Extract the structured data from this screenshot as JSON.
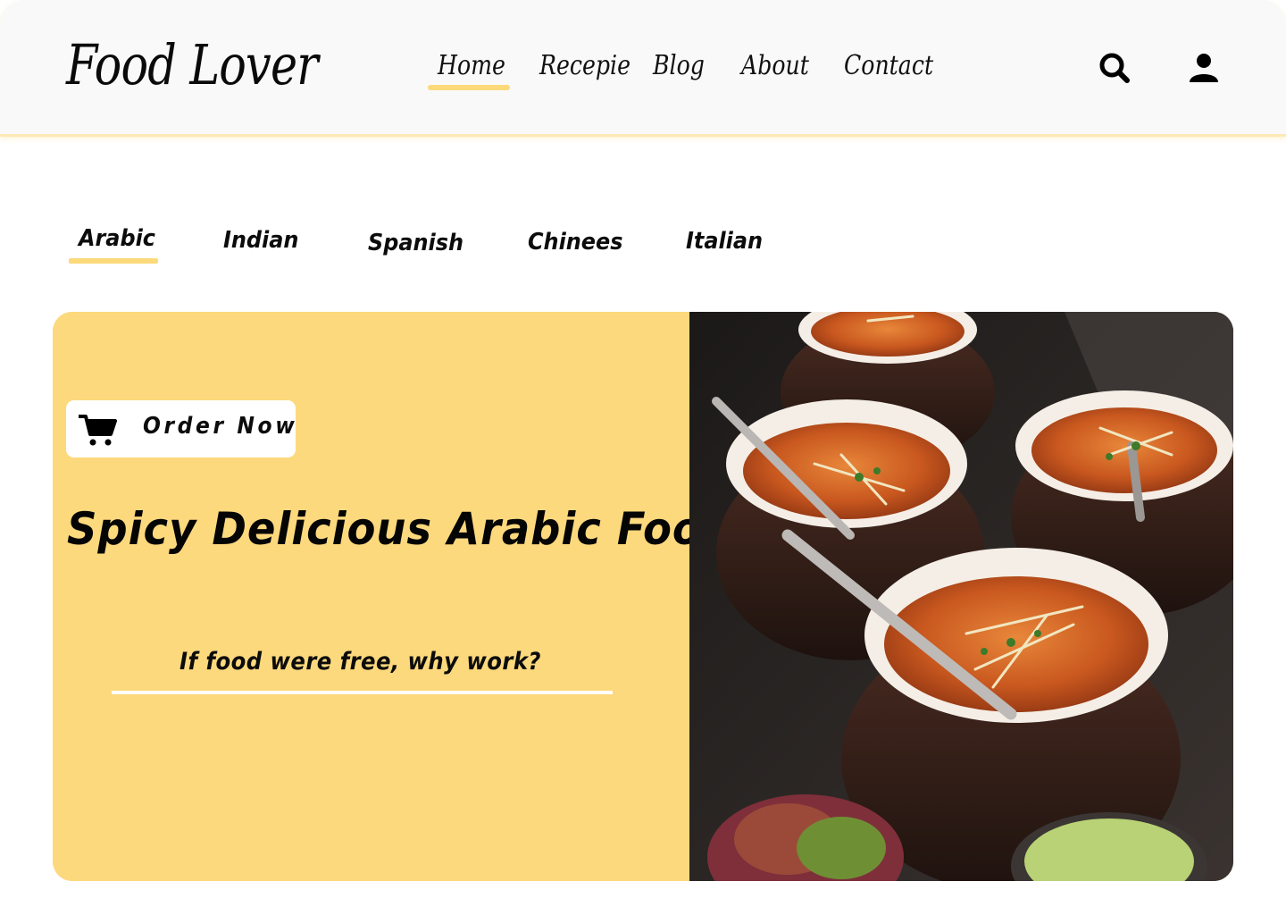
{
  "header": {
    "logo": "Food Lover",
    "nav": [
      {
        "label": "Home",
        "active": true
      },
      {
        "label": "Recepie",
        "active": false
      },
      {
        "label": "Blog",
        "active": false
      },
      {
        "label": "About",
        "active": false
      },
      {
        "label": "Contact",
        "active": false
      }
    ],
    "icons": [
      "search-icon",
      "user-icon"
    ]
  },
  "categories": {
    "tabs": [
      {
        "label": "Arabic",
        "active": true
      },
      {
        "label": "Indian",
        "active": false
      },
      {
        "label": "Spanish",
        "active": false
      },
      {
        "label": "Chinees",
        "active": false
      },
      {
        "label": "Italian",
        "active": false
      }
    ]
  },
  "hero": {
    "order_button": {
      "label": "Order Now",
      "icon": "cart-icon"
    },
    "headline": "Spicy Delicious Arabic Food",
    "tagline": "If food were free, why work?",
    "image": "food-bowls-photo"
  },
  "colors": {
    "accent": "#fcd97a",
    "header_bg": "#f9f9f9",
    "text": "#0a0a0a"
  }
}
